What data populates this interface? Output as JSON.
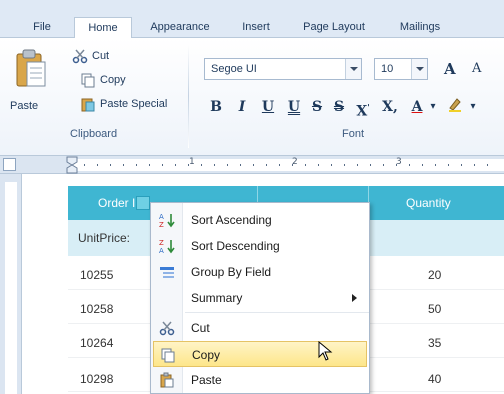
{
  "ribbon": {
    "tabs": [
      {
        "label": "File"
      },
      {
        "label": "Home"
      },
      {
        "label": "Appearance"
      },
      {
        "label": "Insert"
      },
      {
        "label": "Page Layout"
      },
      {
        "label": "Mailings"
      }
    ],
    "active_tab": "Home",
    "clipboard": {
      "paste": "Paste",
      "cut": "Cut",
      "copy": "Copy",
      "paste_special": "Paste Special",
      "group_label": "Clipboard"
    },
    "font": {
      "font_name": "Segoe UI",
      "font_size": "10",
      "bold": "B",
      "italic": "I",
      "underline": "U",
      "double_underline": "U",
      "strikethrough": "S",
      "double_strikethrough": "S",
      "superscript": "X",
      "subscript": "X,",
      "font_color": "A",
      "grow_font": "A",
      "shrink_font": "A",
      "group_label": "Font"
    }
  },
  "ruler": {
    "numbers": [
      "1",
      "2",
      "3"
    ]
  },
  "grid": {
    "columns": [
      "Order ID",
      "Quantity"
    ],
    "group_row_label": "UnitPrice:",
    "rows": [
      {
        "order": "10255",
        "quantity": "20"
      },
      {
        "order": "10258",
        "quantity": "50"
      },
      {
        "order": "10264",
        "quantity": "35"
      },
      {
        "order": "10298",
        "quantity": "40"
      }
    ]
  },
  "context_menu": {
    "items": [
      {
        "label": "Sort Ascending",
        "icon": "sort-ascending-icon"
      },
      {
        "label": "Sort Descending",
        "icon": "sort-descending-icon"
      },
      {
        "label": "Group By Field",
        "icon": "group-by-field-icon"
      },
      {
        "label": "Summary",
        "icon": "submenu-arrow-icon"
      },
      {
        "label": "Cut",
        "icon": "cut-icon"
      },
      {
        "label": "Copy",
        "icon": "copy-icon"
      },
      {
        "label": "Paste",
        "icon": "paste-icon"
      }
    ],
    "highlighted": "Copy"
  },
  "colors": {
    "grid_header": "#3fb6d2",
    "group_row": "#d8eef6",
    "menu_highlight": "#fde68a",
    "ribbon_text": "#1e395b"
  }
}
